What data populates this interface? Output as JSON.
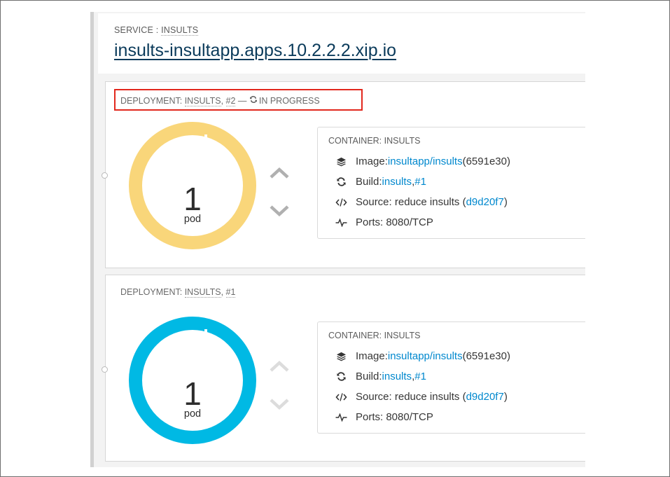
{
  "service": {
    "label_prefix": "SERVICE : ",
    "label_name": "INSULTS",
    "route": "insults-insultapp.apps.10.2.2.2.xip.io"
  },
  "deployments": [
    {
      "title_prefix": "DEPLOYMENT: ",
      "title_name": "INSULTS",
      "title_sep": ", ",
      "revision": "#2",
      "status_dash": " — ",
      "status_text": "IN PROGRESS",
      "pods": "1",
      "pod_unit": "pod",
      "donut_color": "#f9d67a",
      "container": {
        "title": "CONTAINER: INSULTS",
        "image_label": "Image: ",
        "image_link": "insultapp/insults",
        "image_hash": " (6591e30)",
        "build_label": "Build: ",
        "build_link": "insults",
        "build_sep": ", ",
        "build_num": "#1",
        "source_label": "Source: reduce insults (",
        "source_link": "d9d20f7",
        "source_close": ")",
        "ports": "Ports: 8080/TCP"
      }
    },
    {
      "title_prefix": "DEPLOYMENT: ",
      "title_name": "INSULTS",
      "title_sep": ", ",
      "revision": "#1",
      "pods": "1",
      "pod_unit": "pod",
      "donut_color": "#00b9e4",
      "container": {
        "title": "CONTAINER: INSULTS",
        "image_label": "Image: ",
        "image_link": "insultapp/insults",
        "image_hash": " (6591e30)",
        "build_label": "Build: ",
        "build_link": "insults",
        "build_sep": ", ",
        "build_num": "#1",
        "source_label": "Source: reduce insults (",
        "source_link": "d9d20f7",
        "source_close": ")",
        "ports": "Ports: 8080/TCP"
      }
    }
  ],
  "icons": {
    "image": "layers-icon",
    "build": "sync-icon",
    "source": "code-icon",
    "ports": "pulse-icon",
    "scale_up": "chevron-up-icon",
    "scale_down": "chevron-down-icon"
  },
  "colors": {
    "link": "#0088ce",
    "route": "#0a3a5a",
    "highlight": "#e2281d",
    "arrow_active": "#b0b0b0",
    "arrow_disabled": "#dcdcdc"
  }
}
